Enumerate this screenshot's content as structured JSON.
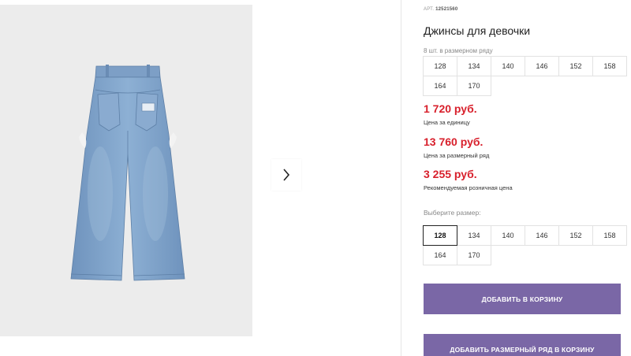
{
  "gallery": {
    "next_arrow": "›"
  },
  "product": {
    "article_label": "АРТ.",
    "article_number": "12521560",
    "title": "Джинсы для девочки",
    "set_note": "8 шт. в размерном ряду",
    "set_sizes": [
      "128",
      "134",
      "140",
      "146",
      "152",
      "158",
      "164",
      "170"
    ]
  },
  "prices": {
    "unit_price": "1 720 руб.",
    "unit_label": "Цена за единицу",
    "set_price": "13 760 руб.",
    "set_label": "Цена за размерный ряд",
    "retail_price": "3 255 руб.",
    "retail_label": "Рекомендуемая розничная цена"
  },
  "size_selector": {
    "label": "Выберите размер:",
    "sizes": [
      "128",
      "134",
      "140",
      "146",
      "152",
      "158",
      "164",
      "170"
    ],
    "selected": "128"
  },
  "actions": {
    "add_to_cart": "ДОБАВИТЬ В КОРЗИНУ",
    "add_set_to_cart": "ДОБАВИТЬ РАЗМЕРНЫЙ РЯД В КОРЗИНУ"
  },
  "colors": {
    "price_red": "#d8202c",
    "button_purple": "#7a67a6",
    "denim": "#7fa2c9"
  }
}
